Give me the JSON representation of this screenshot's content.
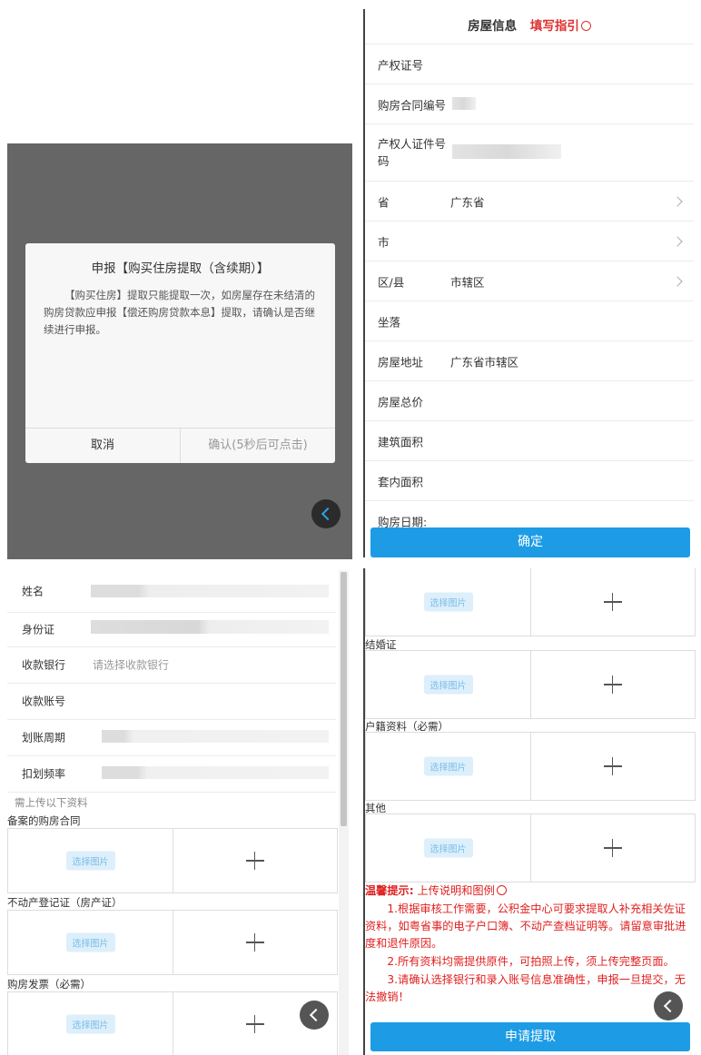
{
  "dialog": {
    "title": "申报【购买住房提取（含续期）】",
    "body": "【购买住房】提取只能提取一次，如房屋存在未结清的购房贷款应申报【偿还购房贷款本息】提取，请确认是否继续进行申报。",
    "cancel": "取消",
    "confirm": "确认(5秒后可点击)"
  },
  "house": {
    "title": "房屋信息",
    "guide": "填写指引",
    "guide_icon": "info-circle-icon",
    "fields": [
      {
        "label": "产权证号",
        "value": ""
      },
      {
        "label": "购房合同编号",
        "value": ""
      },
      {
        "label": "产权人证件号码",
        "value": ""
      },
      {
        "label": "省",
        "value": "广东省"
      },
      {
        "label": "市",
        "value": ""
      },
      {
        "label": "区/县",
        "value": "市辖区"
      },
      {
        "label": "坐落",
        "value": ""
      },
      {
        "label": "房屋地址",
        "value": "广东省市辖区"
      },
      {
        "label": "房屋总价",
        "value": ""
      },
      {
        "label": "建筑面积",
        "value": ""
      },
      {
        "label": "套内面积",
        "value": ""
      },
      {
        "label": "购房日期:",
        "value": ""
      }
    ],
    "ok": "确定"
  },
  "account": {
    "fields": [
      {
        "label": "姓名",
        "placeholder": ""
      },
      {
        "label": "身份证",
        "placeholder": ""
      },
      {
        "label": "收款银行",
        "placeholder": "请选择收款银行"
      },
      {
        "label": "收款账号",
        "placeholder": ""
      },
      {
        "label": "划账周期",
        "placeholder": ""
      },
      {
        "label": "扣划频率",
        "placeholder": ""
      }
    ],
    "upload_hint": "需上传以下资料",
    "pick_label": "选择图片"
  },
  "uploads_left": [
    "备案的购房合同",
    "不动产登记证（房产证）",
    "购房发票（必需）"
  ],
  "uploads_right": [
    "结婚证",
    "户籍资料（必需）",
    "其他"
  ],
  "tips": {
    "heading": "温馨提示:",
    "sub": "上传说明和图例",
    "lines": [
      "1.根据审核工作需要，公积金中心可要求提取人补充相关佐证资料，如粤省事的电子户口簿、不动产查档证明等。请留意审批进度和退件原因。",
      "2.所有资料均需提供原件，可拍照上传，须上传完整页面。",
      "3.请确认选择银行和录入账号信息准确性，申报一旦提交，无法撤销！"
    ],
    "submit": "申请提取"
  },
  "colors": {
    "accent": "#1d9ce5",
    "warning": "#e02020"
  }
}
